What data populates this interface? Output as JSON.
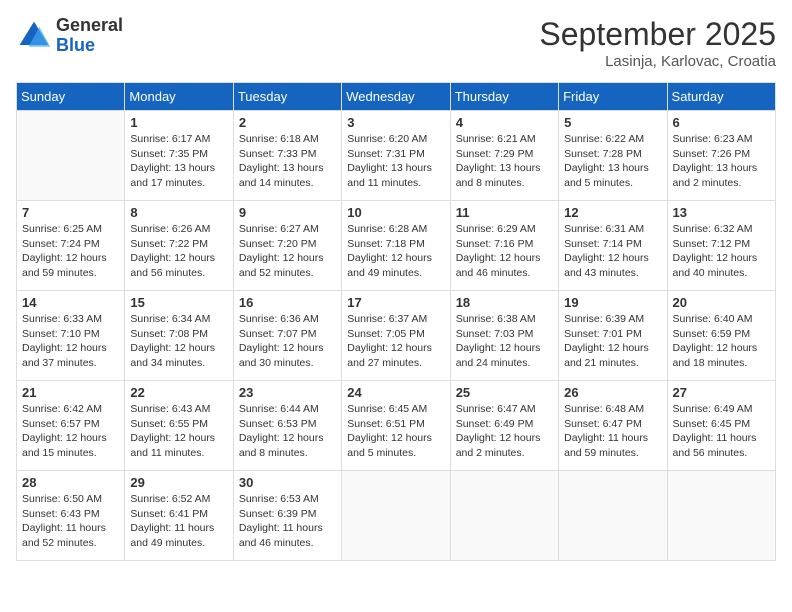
{
  "header": {
    "logo_general": "General",
    "logo_blue": "Blue",
    "month": "September 2025",
    "location": "Lasinja, Karlovac, Croatia"
  },
  "days_of_week": [
    "Sunday",
    "Monday",
    "Tuesday",
    "Wednesday",
    "Thursday",
    "Friday",
    "Saturday"
  ],
  "weeks": [
    [
      {
        "day": "",
        "sunrise": "",
        "sunset": "",
        "daylight": ""
      },
      {
        "day": "1",
        "sunrise": "Sunrise: 6:17 AM",
        "sunset": "Sunset: 7:35 PM",
        "daylight": "Daylight: 13 hours and 17 minutes."
      },
      {
        "day": "2",
        "sunrise": "Sunrise: 6:18 AM",
        "sunset": "Sunset: 7:33 PM",
        "daylight": "Daylight: 13 hours and 14 minutes."
      },
      {
        "day": "3",
        "sunrise": "Sunrise: 6:20 AM",
        "sunset": "Sunset: 7:31 PM",
        "daylight": "Daylight: 13 hours and 11 minutes."
      },
      {
        "day": "4",
        "sunrise": "Sunrise: 6:21 AM",
        "sunset": "Sunset: 7:29 PM",
        "daylight": "Daylight: 13 hours and 8 minutes."
      },
      {
        "day": "5",
        "sunrise": "Sunrise: 6:22 AM",
        "sunset": "Sunset: 7:28 PM",
        "daylight": "Daylight: 13 hours and 5 minutes."
      },
      {
        "day": "6",
        "sunrise": "Sunrise: 6:23 AM",
        "sunset": "Sunset: 7:26 PM",
        "daylight": "Daylight: 13 hours and 2 minutes."
      }
    ],
    [
      {
        "day": "7",
        "sunrise": "Sunrise: 6:25 AM",
        "sunset": "Sunset: 7:24 PM",
        "daylight": "Daylight: 12 hours and 59 minutes."
      },
      {
        "day": "8",
        "sunrise": "Sunrise: 6:26 AM",
        "sunset": "Sunset: 7:22 PM",
        "daylight": "Daylight: 12 hours and 56 minutes."
      },
      {
        "day": "9",
        "sunrise": "Sunrise: 6:27 AM",
        "sunset": "Sunset: 7:20 PM",
        "daylight": "Daylight: 12 hours and 52 minutes."
      },
      {
        "day": "10",
        "sunrise": "Sunrise: 6:28 AM",
        "sunset": "Sunset: 7:18 PM",
        "daylight": "Daylight: 12 hours and 49 minutes."
      },
      {
        "day": "11",
        "sunrise": "Sunrise: 6:29 AM",
        "sunset": "Sunset: 7:16 PM",
        "daylight": "Daylight: 12 hours and 46 minutes."
      },
      {
        "day": "12",
        "sunrise": "Sunrise: 6:31 AM",
        "sunset": "Sunset: 7:14 PM",
        "daylight": "Daylight: 12 hours and 43 minutes."
      },
      {
        "day": "13",
        "sunrise": "Sunrise: 6:32 AM",
        "sunset": "Sunset: 7:12 PM",
        "daylight": "Daylight: 12 hours and 40 minutes."
      }
    ],
    [
      {
        "day": "14",
        "sunrise": "Sunrise: 6:33 AM",
        "sunset": "Sunset: 7:10 PM",
        "daylight": "Daylight: 12 hours and 37 minutes."
      },
      {
        "day": "15",
        "sunrise": "Sunrise: 6:34 AM",
        "sunset": "Sunset: 7:08 PM",
        "daylight": "Daylight: 12 hours and 34 minutes."
      },
      {
        "day": "16",
        "sunrise": "Sunrise: 6:36 AM",
        "sunset": "Sunset: 7:07 PM",
        "daylight": "Daylight: 12 hours and 30 minutes."
      },
      {
        "day": "17",
        "sunrise": "Sunrise: 6:37 AM",
        "sunset": "Sunset: 7:05 PM",
        "daylight": "Daylight: 12 hours and 27 minutes."
      },
      {
        "day": "18",
        "sunrise": "Sunrise: 6:38 AM",
        "sunset": "Sunset: 7:03 PM",
        "daylight": "Daylight: 12 hours and 24 minutes."
      },
      {
        "day": "19",
        "sunrise": "Sunrise: 6:39 AM",
        "sunset": "Sunset: 7:01 PM",
        "daylight": "Daylight: 12 hours and 21 minutes."
      },
      {
        "day": "20",
        "sunrise": "Sunrise: 6:40 AM",
        "sunset": "Sunset: 6:59 PM",
        "daylight": "Daylight: 12 hours and 18 minutes."
      }
    ],
    [
      {
        "day": "21",
        "sunrise": "Sunrise: 6:42 AM",
        "sunset": "Sunset: 6:57 PM",
        "daylight": "Daylight: 12 hours and 15 minutes."
      },
      {
        "day": "22",
        "sunrise": "Sunrise: 6:43 AM",
        "sunset": "Sunset: 6:55 PM",
        "daylight": "Daylight: 12 hours and 11 minutes."
      },
      {
        "day": "23",
        "sunrise": "Sunrise: 6:44 AM",
        "sunset": "Sunset: 6:53 PM",
        "daylight": "Daylight: 12 hours and 8 minutes."
      },
      {
        "day": "24",
        "sunrise": "Sunrise: 6:45 AM",
        "sunset": "Sunset: 6:51 PM",
        "daylight": "Daylight: 12 hours and 5 minutes."
      },
      {
        "day": "25",
        "sunrise": "Sunrise: 6:47 AM",
        "sunset": "Sunset: 6:49 PM",
        "daylight": "Daylight: 12 hours and 2 minutes."
      },
      {
        "day": "26",
        "sunrise": "Sunrise: 6:48 AM",
        "sunset": "Sunset: 6:47 PM",
        "daylight": "Daylight: 11 hours and 59 minutes."
      },
      {
        "day": "27",
        "sunrise": "Sunrise: 6:49 AM",
        "sunset": "Sunset: 6:45 PM",
        "daylight": "Daylight: 11 hours and 56 minutes."
      }
    ],
    [
      {
        "day": "28",
        "sunrise": "Sunrise: 6:50 AM",
        "sunset": "Sunset: 6:43 PM",
        "daylight": "Daylight: 11 hours and 52 minutes."
      },
      {
        "day": "29",
        "sunrise": "Sunrise: 6:52 AM",
        "sunset": "Sunset: 6:41 PM",
        "daylight": "Daylight: 11 hours and 49 minutes."
      },
      {
        "day": "30",
        "sunrise": "Sunrise: 6:53 AM",
        "sunset": "Sunset: 6:39 PM",
        "daylight": "Daylight: 11 hours and 46 minutes."
      },
      {
        "day": "",
        "sunrise": "",
        "sunset": "",
        "daylight": ""
      },
      {
        "day": "",
        "sunrise": "",
        "sunset": "",
        "daylight": ""
      },
      {
        "day": "",
        "sunrise": "",
        "sunset": "",
        "daylight": ""
      },
      {
        "day": "",
        "sunrise": "",
        "sunset": "",
        "daylight": ""
      }
    ]
  ]
}
